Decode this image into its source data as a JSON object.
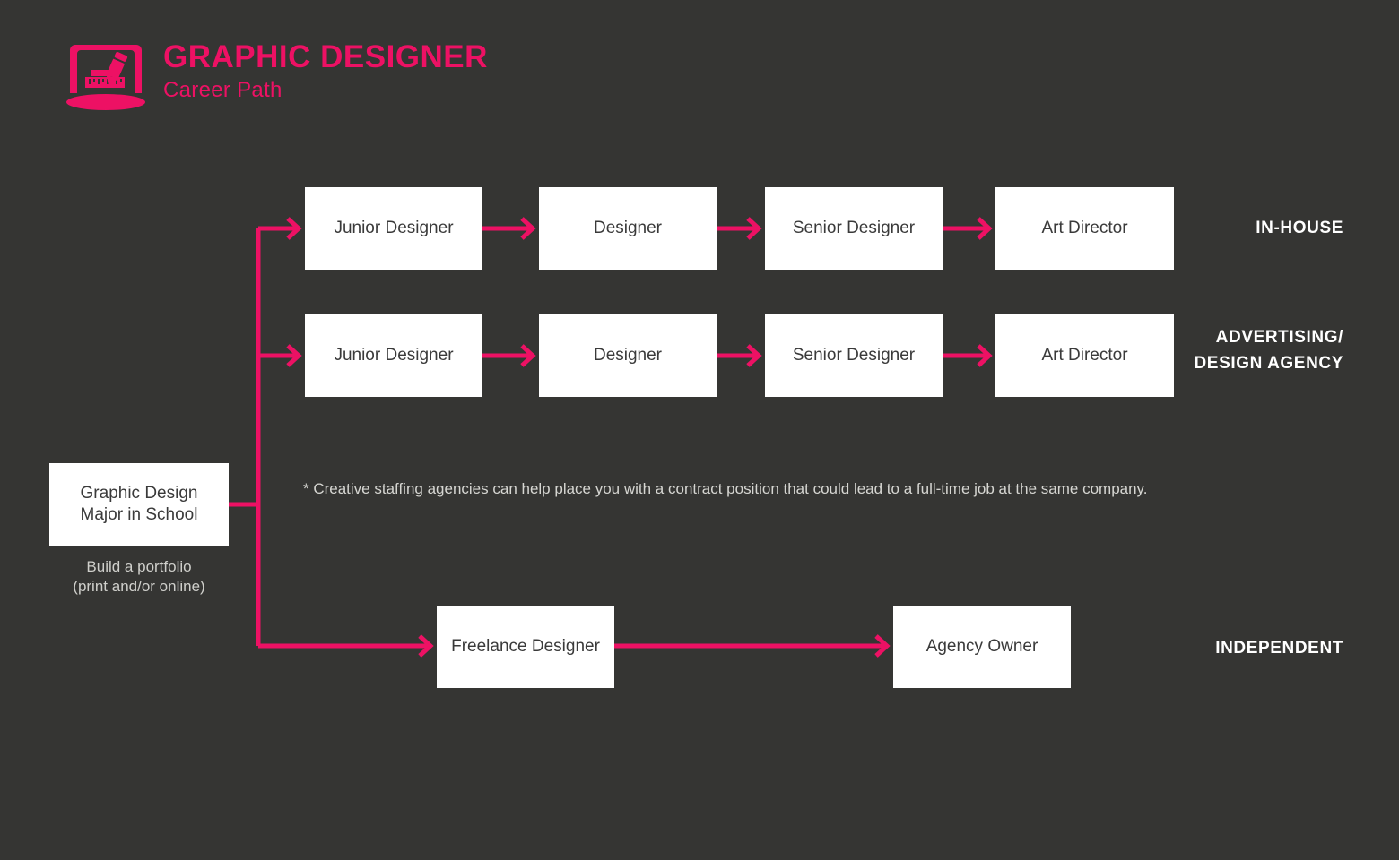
{
  "theme": {
    "background": "#353533",
    "accent": "#ED1164",
    "node_fill": "#FFFFFF",
    "node_text": "#3A3A3A",
    "label_text": "#FFFFFF",
    "muted_text": "#D6D6D2"
  },
  "header": {
    "logo_icon": "laptop-pencil-ruler-icon",
    "title": "GRAPHIC DESIGNER",
    "subtitle": "Career Path"
  },
  "start": {
    "label": "Graphic Design\nMajor in School",
    "line1": "Graphic Design",
    "line2": "Major in School",
    "caption_line1": "Build a portfolio",
    "caption_line2": "(print and/or online)"
  },
  "footnote": "* Creative staffing agencies can help place you with a contract position that could lead to a full-time job at the same company.",
  "tracks": [
    {
      "id": "in-house",
      "label": "IN-HOUSE",
      "label_line1": "IN-HOUSE",
      "label_line2": "",
      "steps": [
        "Junior Designer",
        "Designer",
        "Senior Designer",
        "Art Director"
      ]
    },
    {
      "id": "advertising-design-agency",
      "label": "ADVERTISING/ DESIGN AGENCY",
      "label_line1": "ADVERTISING/",
      "label_line2": "DESIGN AGENCY",
      "steps": [
        "Junior Designer",
        "Designer",
        "Senior Designer",
        "Art Director"
      ]
    },
    {
      "id": "independent",
      "label": "INDEPENDENT",
      "label_line1": "INDEPENDENT",
      "label_line2": "",
      "steps": [
        "Freelance Designer",
        "Agency Owner"
      ]
    }
  ],
  "chart_data": {
    "type": "diagram",
    "title": "GRAPHIC DESIGNER Career Path",
    "start_node": "Graphic Design Major in School",
    "branches": 3,
    "edges": [
      {
        "from": "Graphic Design Major in School",
        "to": "Junior Designer (In-House)"
      },
      {
        "from": "Junior Designer (In-House)",
        "to": "Designer (In-House)"
      },
      {
        "from": "Designer (In-House)",
        "to": "Senior Designer (In-House)"
      },
      {
        "from": "Senior Designer (In-House)",
        "to": "Art Director (In-House)"
      },
      {
        "from": "Graphic Design Major in School",
        "to": "Junior Designer (Agency)"
      },
      {
        "from": "Junior Designer (Agency)",
        "to": "Designer (Agency)"
      },
      {
        "from": "Designer (Agency)",
        "to": "Senior Designer (Agency)"
      },
      {
        "from": "Senior Designer (Agency)",
        "to": "Art Director (Agency)"
      },
      {
        "from": "Graphic Design Major in School",
        "to": "Freelance Designer"
      },
      {
        "from": "Freelance Designer",
        "to": "Agency Owner"
      }
    ]
  }
}
